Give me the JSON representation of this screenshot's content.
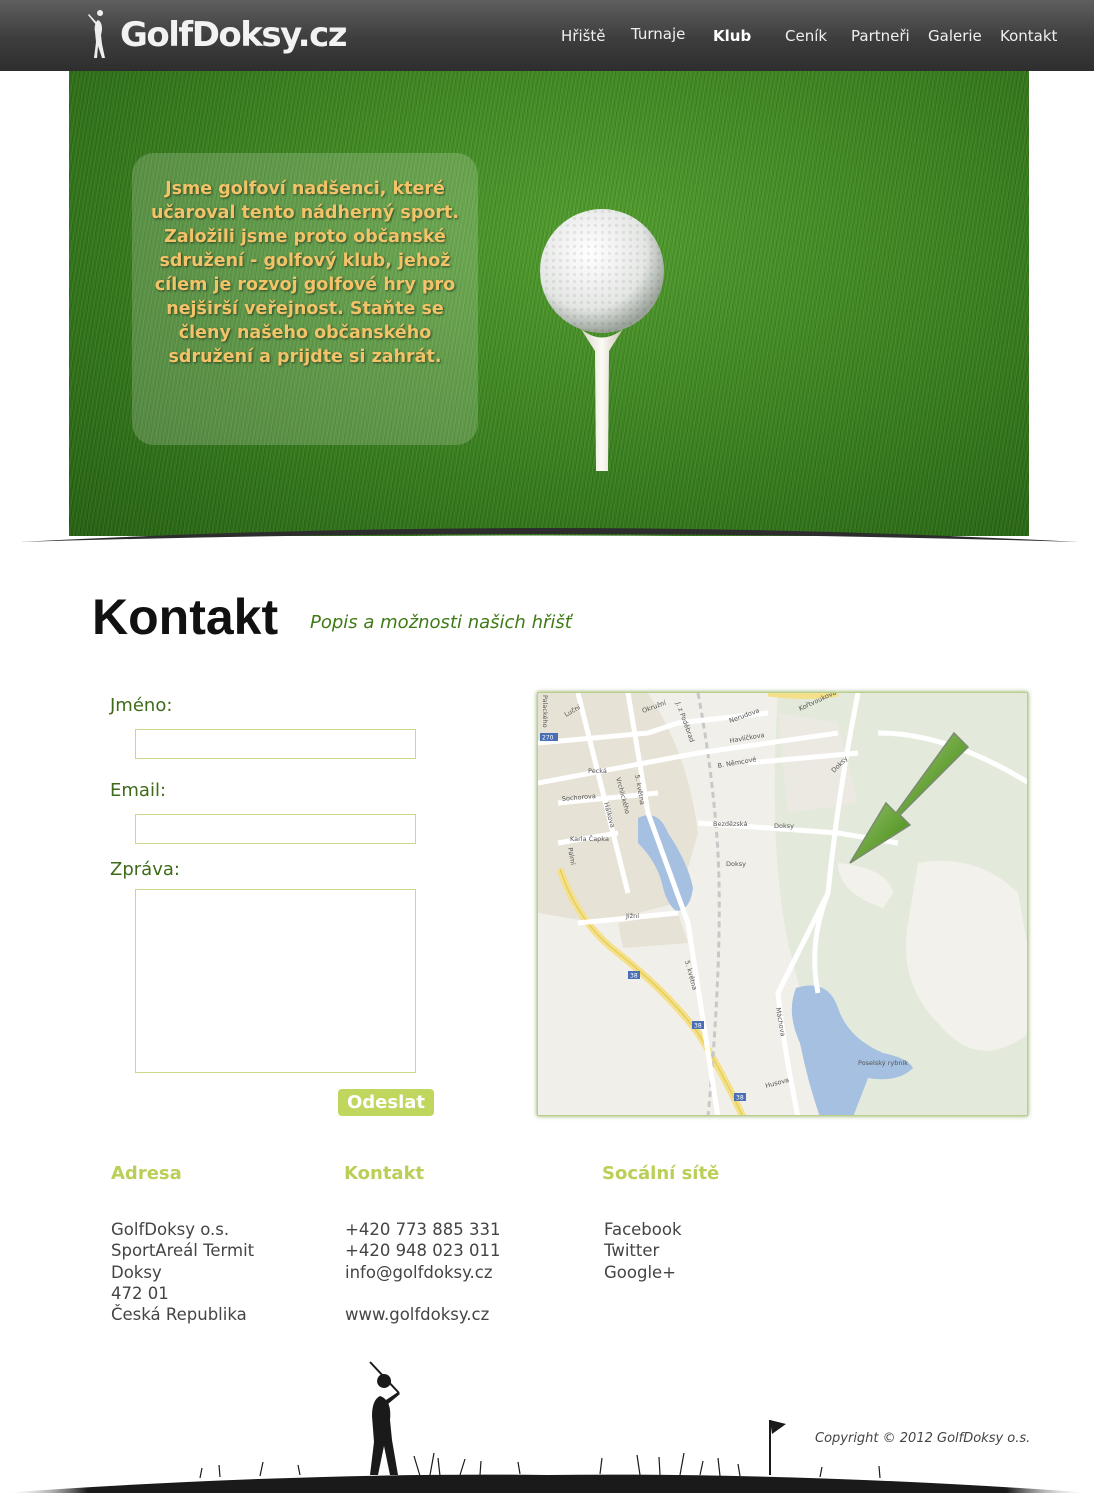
{
  "header": {
    "logo_text": "GolfDoksy.cz",
    "nav": [
      {
        "label": "Hřiště"
      },
      {
        "label": "Turnaje"
      },
      {
        "label": "Klub",
        "active": true
      },
      {
        "label": "Ceník"
      },
      {
        "label": "Partneři"
      },
      {
        "label": "Galerie"
      },
      {
        "label": "Kontakt"
      }
    ]
  },
  "hero": {
    "text": "Jsme golfoví nadšenci, které učaroval tento nádherný sport. Založili jsme proto občanské sdružení - golfový klub, jehož cílem je rozvoj golfové hry pro nejširší veřejnost. Staňte se členy našeho občanského sdružení a prijdte si zahrát."
  },
  "page": {
    "title": "Kontakt",
    "subtitle": "Popis a možnosti našich hřišť"
  },
  "form": {
    "name_label": "Jméno:",
    "email_label": "Email:",
    "message_label": "Zpráva:",
    "name_value": "",
    "email_value": "",
    "message_value": "",
    "submit_label": "Odeslat"
  },
  "map": {
    "streets": [
      "Luční",
      "Okružní",
      "J. z Poděbrad",
      "Nerudova",
      "Kořtvoukova",
      "Havlíčkova",
      "B. Němcové",
      "Doksy",
      "Palackého",
      "Pecká",
      "Sochorova",
      "Vrchlického",
      "5. května",
      "Bezdězská",
      "Hálkova",
      "Karla Čapka",
      "Palmí",
      "Jižní",
      "Husova",
      "Poselský rybník",
      "Máchova"
    ],
    "route_badges": [
      "270",
      "38",
      "38",
      "38"
    ]
  },
  "footer": {
    "columns": [
      {
        "heading": "Adresa",
        "lines": [
          "GolfDoksy o.s.",
          "SportAreál Termit",
          "Doksy",
          "472 01",
          "Česká Republika"
        ]
      },
      {
        "heading": "Kontakt",
        "lines": [
          "+420 773 885 331",
          "+420 948 023 011",
          "info@golfdoksy.cz",
          "",
          "www.golfdoksy.cz"
        ]
      },
      {
        "heading": "Socální sítě",
        "lines": [
          "Facebook",
          "Twitter",
          "Google+"
        ]
      }
    ],
    "copyright": "Copyright © 2012 GolfDoksy o.s."
  },
  "colors": {
    "header_bg": "#3d3d3d",
    "accent_green": "#3f7a17",
    "heading_lime": "#b9cf57",
    "hero_text": "#f3c36a",
    "button": "#bfd75e"
  }
}
